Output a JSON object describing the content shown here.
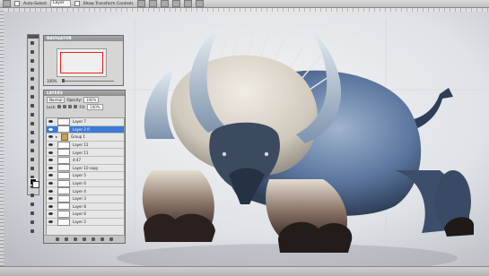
{
  "options_bar": {
    "auto_select_label": "Auto-Select",
    "auto_select_value": "Layer",
    "show_transform_label": "Show Transform Controls"
  },
  "navigator": {
    "title": "NAVIGATOR",
    "zoom": "100%"
  },
  "layers": {
    "title": "LAYERS",
    "blend_mode": "Normal",
    "opacity_label": "Opacity:",
    "opacity_value": "100%",
    "lock_label": "Lock:",
    "fill_label": "Fill:",
    "fill_value": "100%",
    "items": [
      {
        "name": "Layer 7",
        "active": false,
        "group": false
      },
      {
        "name": "Layer 2 fi",
        "active": true,
        "group": false
      },
      {
        "name": "Group 1",
        "active": false,
        "group": true
      },
      {
        "name": "Layer 12",
        "active": false,
        "group": false
      },
      {
        "name": "Layer 11",
        "active": false,
        "group": false
      },
      {
        "name": "4:47",
        "active": false,
        "group": false
      },
      {
        "name": "Layer 10 copy",
        "active": false,
        "group": false
      },
      {
        "name": "Layer 5",
        "active": false,
        "group": false
      },
      {
        "name": "Layer 6",
        "active": false,
        "group": false
      },
      {
        "name": "Layer 4",
        "active": false,
        "group": false
      },
      {
        "name": "Layer 3",
        "active": false,
        "group": false
      },
      {
        "name": "Layer 8",
        "active": false,
        "group": false
      },
      {
        "name": "Layer 6",
        "active": false,
        "group": false
      },
      {
        "name": "Layer 2",
        "active": false,
        "group": false
      }
    ]
  },
  "colors": {
    "background_mist": "#dfe2e6",
    "selection_blue": "#3b7ad6",
    "creature_fur": "#d9d4cc",
    "creature_body": "#5b77a0",
    "creature_legs": "#4b3a33"
  },
  "icons": [
    "move-icon",
    "marquee-icon",
    "lasso-icon",
    "crop-icon",
    "eyedropper-icon",
    "brush-icon",
    "stamp-icon",
    "eraser-icon",
    "gradient-icon",
    "dodge-icon",
    "pen-icon",
    "type-icon",
    "path-select-icon",
    "shape-icon",
    "hand-icon",
    "zoom-icon"
  ]
}
